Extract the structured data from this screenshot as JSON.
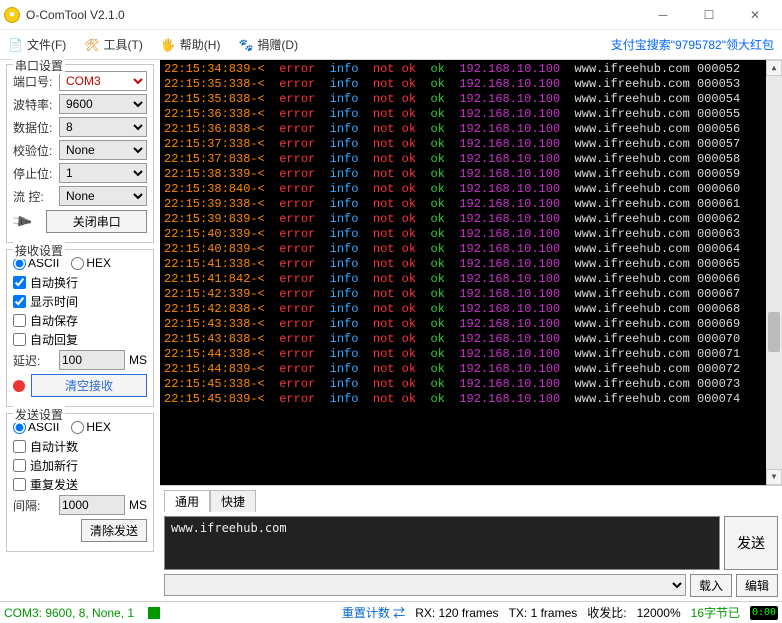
{
  "window": {
    "title": "O-ComTool V2.1.0"
  },
  "menu": {
    "file": "文件(F)",
    "tools": "工具(T)",
    "help": "帮助(H)",
    "donate": "捐赠(D)",
    "alipay_notice": "支付宝搜索\"9795782\"领大红包"
  },
  "serial_group": {
    "legend": "串口设置",
    "port_label": "端口号:",
    "port_value": "COM3",
    "baud_label": "波特率:",
    "baud_value": "9600",
    "data_label": "数据位:",
    "data_value": "8",
    "parity_label": "校验位:",
    "parity_value": "None",
    "stop_label": "停止位:",
    "stop_value": "1",
    "flow_label": "流  控:",
    "flow_value": "None",
    "close_btn": "关闭串口"
  },
  "recv_group": {
    "legend": "接收设置",
    "ascii": "ASCII",
    "hex": "HEX",
    "wrap": "自动换行",
    "showtime": "显示时间",
    "autosave": "自动保存",
    "autoreply": "自动回复",
    "delay_label": "延迟:",
    "delay_value": "100",
    "delay_unit": "MS",
    "clear_recv": "清空接收"
  },
  "send_group": {
    "legend": "发送设置",
    "ascii": "ASCII",
    "hex": "HEX",
    "autocount": "自动计数",
    "appendnl": "追加新行",
    "repeat": "重复发送",
    "interval_label": "间隔:",
    "interval_value": "1000",
    "interval_unit": "MS",
    "clear_send": "清除发送"
  },
  "terminal": {
    "lines": [
      {
        "t": "22:15:34:839-<",
        "n": "000052"
      },
      {
        "t": "22:15:35:338-<",
        "n": "000053"
      },
      {
        "t": "22:15:35:838-<",
        "n": "000054"
      },
      {
        "t": "22:15:36:338-<",
        "n": "000055"
      },
      {
        "t": "22:15:36:838-<",
        "n": "000056"
      },
      {
        "t": "22:15:37:338-<",
        "n": "000057"
      },
      {
        "t": "22:15:37:838-<",
        "n": "000058"
      },
      {
        "t": "22:15:38:339-<",
        "n": "000059"
      },
      {
        "t": "22:15:38:840-<",
        "n": "000060"
      },
      {
        "t": "22:15:39:338-<",
        "n": "000061"
      },
      {
        "t": "22:15:39:839-<",
        "n": "000062"
      },
      {
        "t": "22:15:40:339-<",
        "n": "000063"
      },
      {
        "t": "22:15:40:839-<",
        "n": "000064"
      },
      {
        "t": "22:15:41:338-<",
        "n": "000065"
      },
      {
        "t": "22:15:41:842-<",
        "n": "000066"
      },
      {
        "t": "22:15:42:339-<",
        "n": "000067"
      },
      {
        "t": "22:15:42:838-<",
        "n": "000068"
      },
      {
        "t": "22:15:43:338-<",
        "n": "000069"
      },
      {
        "t": "22:15:43:838-<",
        "n": "000070"
      },
      {
        "t": "22:15:44:338-<",
        "n": "000071"
      },
      {
        "t": "22:15:44:839-<",
        "n": "000072"
      },
      {
        "t": "22:15:45:338-<",
        "n": "000073"
      },
      {
        "t": "22:15:45:839-<",
        "n": "000074"
      }
    ],
    "tokens": {
      "error": "error",
      "info": "info",
      "notok": "not ok",
      "ok": "ok",
      "ip": "192.168.10.100",
      "host": "www.ifreehub.com"
    }
  },
  "tx": {
    "tabs": {
      "general": "通用",
      "quick": "快捷"
    },
    "content": "www.ifreehub.com",
    "send_btn": "发送",
    "load_btn": "载入",
    "edit_btn": "编辑"
  },
  "status": {
    "port": "COM3: 9600, 8, None, 1",
    "resend_label": "重置计数",
    "rx": "RX: 120 frames",
    "tx": "TX: 1 frames",
    "ratio_label": "收发比:",
    "ratio_value": "12000%",
    "bytes": "16字节已",
    "clock": "0:00"
  }
}
